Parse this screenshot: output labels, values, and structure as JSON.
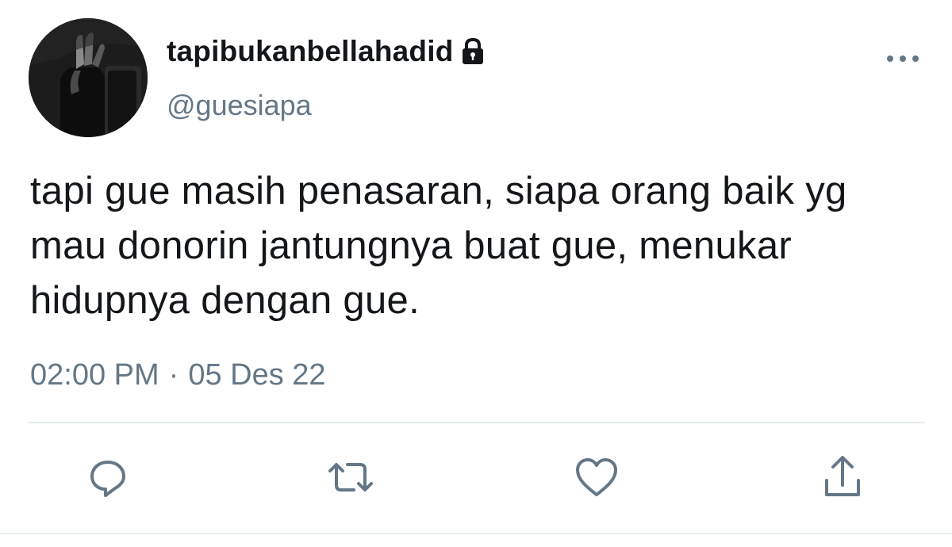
{
  "tweet": {
    "display_name": "tapibukanbellahadid",
    "handle": "@guesiapa",
    "text": "tapi gue masih penasaran, siapa orang baik yg mau donorin jantungnya buat gue, menukar hidupnya dengan gue.",
    "time": "02:00 PM",
    "separator": "·",
    "date": "05 Des 22"
  },
  "icons": {
    "protected": "lock-icon",
    "more": "more-icon",
    "reply": "reply-icon",
    "retweet": "retweet-icon",
    "like": "heart-icon",
    "share": "share-icon"
  },
  "colors": {
    "text": "#14171a",
    "secondary": "#657786",
    "icon": "#657786",
    "divider": "#e6ecf0"
  }
}
